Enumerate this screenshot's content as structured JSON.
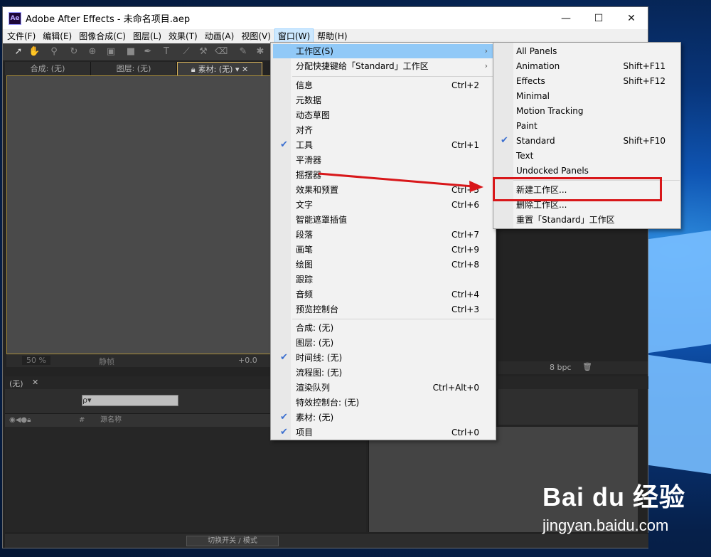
{
  "window": {
    "title": "Adobe After Effects - 未命名项目.aep",
    "app_icon": "Ae",
    "controls": [
      "—",
      "☐",
      "✕"
    ]
  },
  "menubar": {
    "items": [
      "文件(F)",
      "编辑(E)",
      "图像合成(C)",
      "图层(L)",
      "效果(T)",
      "动画(A)",
      "视图(V)",
      "窗口(W)",
      "帮助(H)"
    ],
    "active": "窗口(W)"
  },
  "panel_tabs": [
    "合成: (无)",
    "图层: (无)",
    "素材: (无)"
  ],
  "viewer_bar": {
    "zoom": "50 %",
    "quality": "静帧",
    "exposure": "+0.0"
  },
  "project_bar": {
    "bpc": "8 bpc"
  },
  "timeline": {
    "tab": "(无)",
    "search_placeholder": "ρ▾",
    "col_name": "源名称",
    "col_num": "#",
    "switch_btn": "切换开关 / 模式"
  },
  "window_menu": {
    "group1": [
      {
        "label": "工作区(S)",
        "submenu": true,
        "highlight": true
      },
      {
        "label": "分配快捷键给「Standard」工作区",
        "submenu": true
      }
    ],
    "group2": [
      {
        "label": "信息",
        "shortcut": "Ctrl+2"
      },
      {
        "label": "元数据"
      },
      {
        "label": "动态草图"
      },
      {
        "label": "对齐"
      },
      {
        "label": "工具",
        "shortcut": "Ctrl+1",
        "checked": true
      },
      {
        "label": "平滑器"
      },
      {
        "label": "摇摆器"
      },
      {
        "label": "效果和预置",
        "shortcut": "Ctrl+5"
      },
      {
        "label": "文字",
        "shortcut": "Ctrl+6"
      },
      {
        "label": "智能遮罩插值"
      },
      {
        "label": "段落",
        "shortcut": "Ctrl+7"
      },
      {
        "label": "画笔",
        "shortcut": "Ctrl+9"
      },
      {
        "label": "绘图",
        "shortcut": "Ctrl+8"
      },
      {
        "label": "跟踪"
      },
      {
        "label": "音频",
        "shortcut": "Ctrl+4"
      },
      {
        "label": "预览控制台",
        "shortcut": "Ctrl+3"
      }
    ],
    "group3": [
      {
        "label": "合成: (无)"
      },
      {
        "label": "图层: (无)"
      },
      {
        "label": "时间线: (无)",
        "checked": true
      },
      {
        "label": "流程图: (无)"
      },
      {
        "label": "渲染队列",
        "shortcut": "Ctrl+Alt+0"
      },
      {
        "label": "特效控制台: (无)"
      },
      {
        "label": "素材: (无)",
        "checked": true
      },
      {
        "label": "项目",
        "shortcut": "Ctrl+0",
        "checked": true
      }
    ]
  },
  "workspace_menu": {
    "group1": [
      {
        "label": "All Panels",
        "shortcut": ""
      },
      {
        "label": "Animation",
        "shortcut": "Shift+F11"
      },
      {
        "label": "Effects",
        "shortcut": "Shift+F12"
      },
      {
        "label": "Minimal",
        "shortcut": ""
      },
      {
        "label": "Motion Tracking",
        "shortcut": ""
      },
      {
        "label": "Paint",
        "shortcut": ""
      },
      {
        "label": "Standard",
        "shortcut": "Shift+F10",
        "checked": true
      },
      {
        "label": "Text",
        "shortcut": ""
      },
      {
        "label": "Undocked Panels",
        "shortcut": ""
      }
    ],
    "group2": [
      {
        "label": "新建工作区..."
      },
      {
        "label": "删除工作区..."
      },
      {
        "label": "重置「Standard」工作区"
      }
    ]
  },
  "watermark": {
    "brand": "Bai du 经验",
    "url": "jingyan.baidu.com"
  },
  "colors": {
    "callout": "#d8171a",
    "arrow": "#d8171a",
    "check": "#3b6fd0",
    "highlight": "#91c9f7"
  }
}
